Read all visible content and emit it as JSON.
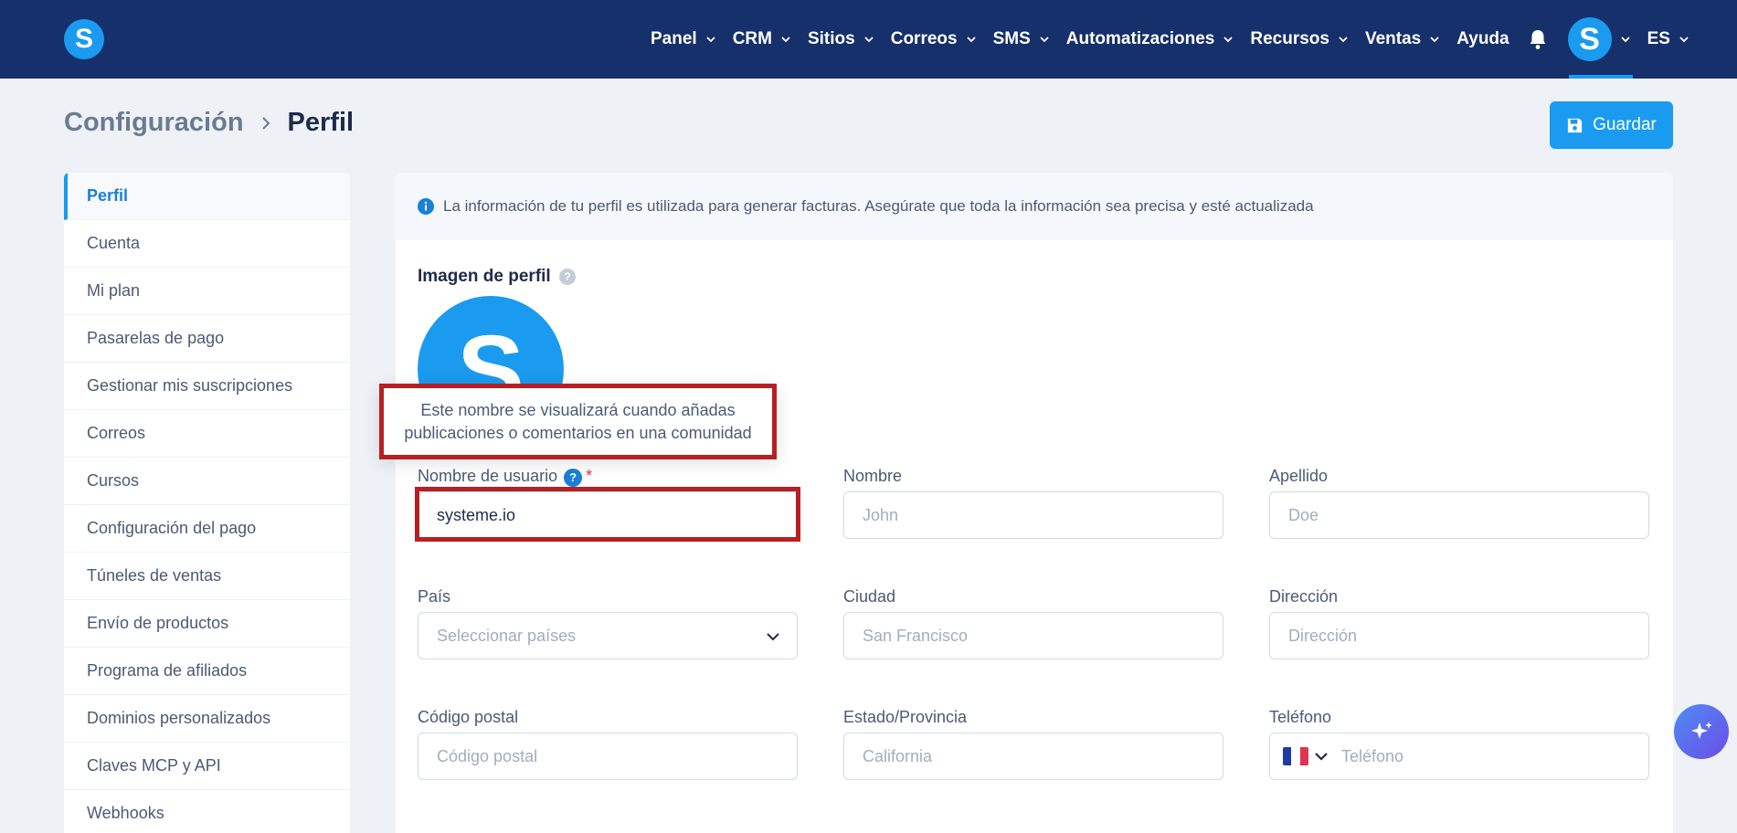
{
  "brand": {
    "logo_letter": "S",
    "accent": "#1a9bf0",
    "nav_bg": "#15306a",
    "highlight": "#b81f23"
  },
  "nav": {
    "items": [
      {
        "label": "Panel",
        "has_menu": true
      },
      {
        "label": "CRM",
        "has_menu": true
      },
      {
        "label": "Sitios",
        "has_menu": true
      },
      {
        "label": "Correos",
        "has_menu": true
      },
      {
        "label": "SMS",
        "has_menu": true
      },
      {
        "label": "Automatizaciones",
        "has_menu": true
      },
      {
        "label": "Recursos",
        "has_menu": true
      },
      {
        "label": "Ventas",
        "has_menu": true
      },
      {
        "label": "Ayuda",
        "has_menu": false
      }
    ],
    "bell_icon": "bell-icon",
    "avatar_letter": "S",
    "language": "ES"
  },
  "breadcrumb": {
    "root": "Configuración",
    "current": "Perfil"
  },
  "toolbar": {
    "save_label": "Guardar",
    "save_icon": "floppy-disk-icon"
  },
  "sidebar": {
    "items": [
      {
        "label": "Perfil",
        "active": true
      },
      {
        "label": "Cuenta"
      },
      {
        "label": "Mi plan"
      },
      {
        "label": "Pasarelas de pago"
      },
      {
        "label": "Gestionar mis suscripciones"
      },
      {
        "label": "Correos"
      },
      {
        "label": "Cursos"
      },
      {
        "label": "Configuración del pago"
      },
      {
        "label": "Túneles de ventas"
      },
      {
        "label": "Envío de productos"
      },
      {
        "label": "Programa de afiliados"
      },
      {
        "label": "Dominios personalizados"
      },
      {
        "label": "Claves MCP y API"
      },
      {
        "label": "Webhooks"
      }
    ]
  },
  "main": {
    "info_text": "La información de tu perfil es utilizada para generar facturas. Asegúrate que toda la información sea precisa y esté actualizada",
    "profile_image": {
      "label": "Imagen de perfil",
      "avatar_letter": "S"
    },
    "tooltip": "Este nombre se visualizará cuando añadas publicaciones o comentarios en una comunidad",
    "fields": {
      "username": {
        "label": "Nombre de usuario",
        "help": "?",
        "required_mark": "*",
        "value": "systeme.io"
      },
      "first_name": {
        "label": "Nombre",
        "placeholder": "John"
      },
      "last_name": {
        "label": "Apellido",
        "placeholder": "Doe"
      },
      "country": {
        "label": "País",
        "placeholder": "Seleccionar países"
      },
      "city": {
        "label": "Ciudad",
        "placeholder": "San Francisco"
      },
      "address": {
        "label": "Dirección",
        "placeholder": "Dirección"
      },
      "postal_code": {
        "label": "Código postal",
        "placeholder": "Código postal"
      },
      "state": {
        "label": "Estado/Provincia",
        "placeholder": "California"
      },
      "phone": {
        "label": "Teléfono",
        "placeholder": "Teléfono",
        "flag": "france-flag-icon"
      }
    }
  }
}
